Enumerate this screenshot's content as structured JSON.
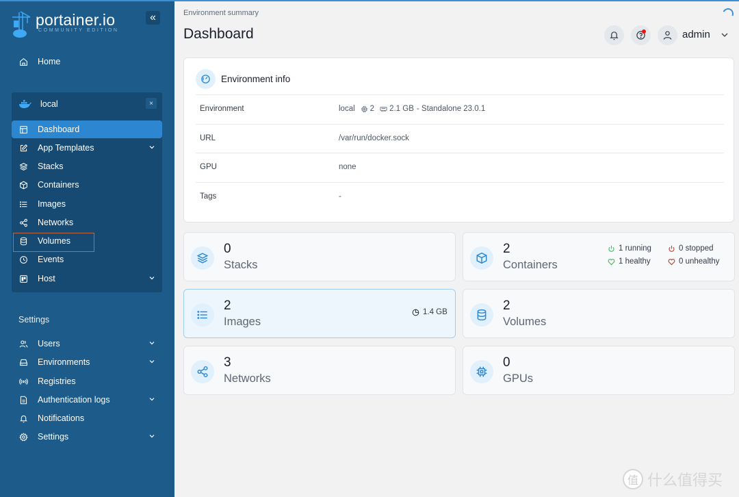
{
  "app": {
    "logo_main": "portainer.io",
    "logo_sub": "COMMUNITY EDITION",
    "collapse_icon": "«"
  },
  "sidebar": {
    "home": {
      "label": "Home",
      "icon": "home-icon"
    },
    "environment": {
      "name": "local",
      "icon": "docker-icon",
      "close_label": "×",
      "items": [
        {
          "label": "Dashboard",
          "icon": "dashboard-icon",
          "active": true
        },
        {
          "label": "App Templates",
          "icon": "edit-icon",
          "expandable": true
        },
        {
          "label": "Stacks",
          "icon": "layers-icon"
        },
        {
          "label": "Containers",
          "icon": "box-icon"
        },
        {
          "label": "Images",
          "icon": "list-icon"
        },
        {
          "label": "Networks",
          "icon": "share-icon"
        },
        {
          "label": "Volumes",
          "icon": "database-icon",
          "highlighted": true
        },
        {
          "label": "Events",
          "icon": "clock-icon"
        },
        {
          "label": "Host",
          "icon": "host-icon",
          "expandable": true
        }
      ]
    },
    "settings_title": "Settings",
    "settings_items": [
      {
        "label": "Users",
        "icon": "users-icon",
        "expandable": true
      },
      {
        "label": "Environments",
        "icon": "hard-drive-icon",
        "expandable": true
      },
      {
        "label": "Registries",
        "icon": "radio-icon"
      },
      {
        "label": "Authentication logs",
        "icon": "file-text-icon",
        "expandable": true
      },
      {
        "label": "Notifications",
        "icon": "bell-icon"
      },
      {
        "label": "Settings",
        "icon": "gear-icon",
        "expandable": true
      }
    ]
  },
  "header": {
    "breadcrumb": "Environment summary",
    "title": "Dashboard",
    "user": "admin"
  },
  "env_info": {
    "title": "Environment info",
    "rows": [
      {
        "label": "Environment",
        "value": "local",
        "cpu": "2",
        "memory": "2.1 GB",
        "suffix": "- Standalone 23.0.1"
      },
      {
        "label": "URL",
        "value": "/var/run/docker.sock"
      },
      {
        "label": "GPU",
        "value": "none"
      },
      {
        "label": "Tags",
        "value": "-"
      }
    ]
  },
  "stats": {
    "stacks": {
      "count": "0",
      "label": "Stacks"
    },
    "containers": {
      "count": "2",
      "label": "Containers",
      "running": "1 running",
      "stopped": "0 stopped",
      "healthy": "1 healthy",
      "unhealthy": "0 unhealthy"
    },
    "images": {
      "count": "2",
      "label": "Images",
      "size": "1.4 GB"
    },
    "volumes": {
      "count": "2",
      "label": "Volumes"
    },
    "networks": {
      "count": "3",
      "label": "Networks"
    },
    "gpus": {
      "count": "0",
      "label": "GPUs"
    }
  },
  "colors": {
    "sidebar_bg": "#1d5b8a",
    "accent": "#2d87d0",
    "success": "#3dbb5a",
    "danger": "#c0392b"
  },
  "watermark": {
    "glyph": "值",
    "text": "什么值得买"
  }
}
